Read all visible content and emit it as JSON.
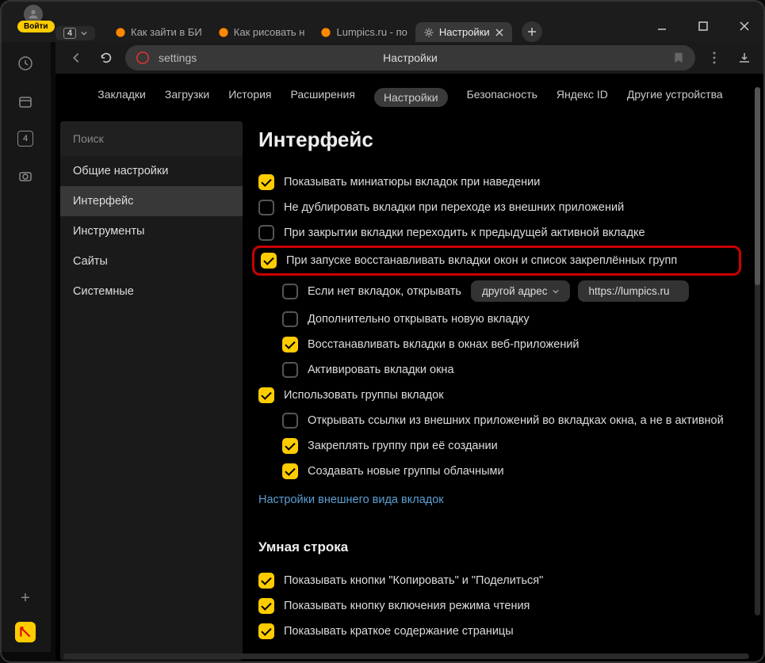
{
  "titlebar": {
    "login": "Войти",
    "counter": "4",
    "tabs": [
      {
        "label": "Как зайти в БИ",
        "favicon": "orange"
      },
      {
        "label": "Как рисовать н",
        "favicon": "orange"
      },
      {
        "label": "Lumpics.ru - по",
        "favicon": "orange"
      },
      {
        "label": "Настройки",
        "favicon": "gear",
        "active": true
      }
    ]
  },
  "toolbar": {
    "address": "settings",
    "page_title": "Настройки"
  },
  "sidebar_counter": "4",
  "nav_tabs": [
    "Закладки",
    "Загрузки",
    "История",
    "Расширения",
    "Настройки",
    "Безопасность",
    "Яндекс ID",
    "Другие устройства"
  ],
  "nav_active_index": 4,
  "side_panel": {
    "search_placeholder": "Поиск",
    "items": [
      "Общие настройки",
      "Интерфейс",
      "Инструменты",
      "Сайты",
      "Системные"
    ],
    "active_index": 1
  },
  "settings": {
    "title": "Интерфейс",
    "options": [
      {
        "checked": true,
        "indent": 0,
        "label": "Показывать миниатюры вкладок при наведении"
      },
      {
        "checked": false,
        "indent": 0,
        "label": "Не дублировать вкладки при переходе из внешних приложений"
      },
      {
        "checked": false,
        "indent": 0,
        "label": "При закрытии вкладки переходить к предыдущей активной вкладке"
      },
      {
        "checked": true,
        "indent": 0,
        "label": "При запуске восстанавливать вкладки окон и список закреплённых групп",
        "highlight": true
      },
      {
        "checked": false,
        "indent": 1,
        "label": "Если нет вкладок, открывать",
        "select_value": "другой адрес",
        "input_value": "https://lumpics.ru"
      },
      {
        "checked": false,
        "indent": 1,
        "label": "Дополнительно открывать новую вкладку"
      },
      {
        "checked": true,
        "indent": 1,
        "label": "Восстанавливать вкладки в окнах веб-приложений"
      },
      {
        "checked": false,
        "indent": 1,
        "label": "Активировать вкладки окна"
      },
      {
        "checked": true,
        "indent": 0,
        "label": "Использовать группы вкладок"
      },
      {
        "checked": false,
        "indent": 1,
        "label": "Открывать ссылки из внешних приложений во вкладках окна, а не в активной"
      },
      {
        "checked": true,
        "indent": 1,
        "label": "Закреплять группу при её создании"
      },
      {
        "checked": true,
        "indent": 1,
        "label": "Создавать новые группы облачными"
      }
    ],
    "link": "Настройки внешнего вида вкладок",
    "sub_title": "Умная строка",
    "sub_options": [
      {
        "checked": true,
        "label": "Показывать кнопки \"Копировать\" и \"Поделиться\""
      },
      {
        "checked": true,
        "label": "Показывать кнопку включения режима чтения"
      },
      {
        "checked": true,
        "label": "Показывать краткое содержание страницы"
      }
    ]
  }
}
